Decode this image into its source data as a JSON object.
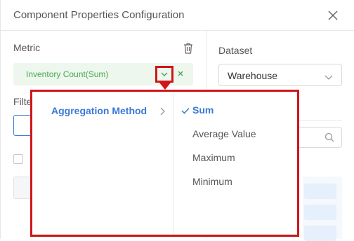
{
  "dialog": {
    "title": "Component Properties Configuration"
  },
  "left": {
    "metric_label": "Metric",
    "metric_chip": "Inventory Count(Sum)",
    "filter_label": "Filte"
  },
  "right": {
    "dataset_label": "Dataset",
    "dataset_value": "Warehouse"
  },
  "popup": {
    "menu_item": "Aggregation Method",
    "options": [
      "Sum",
      "Average Value",
      "Maximum",
      "Minimum"
    ],
    "selected": "Sum"
  },
  "colors": {
    "accent": "#3a78d6",
    "highlight": "#d0161a",
    "chip_bg": "#edf7ee",
    "chip_text": "#46a84f"
  }
}
